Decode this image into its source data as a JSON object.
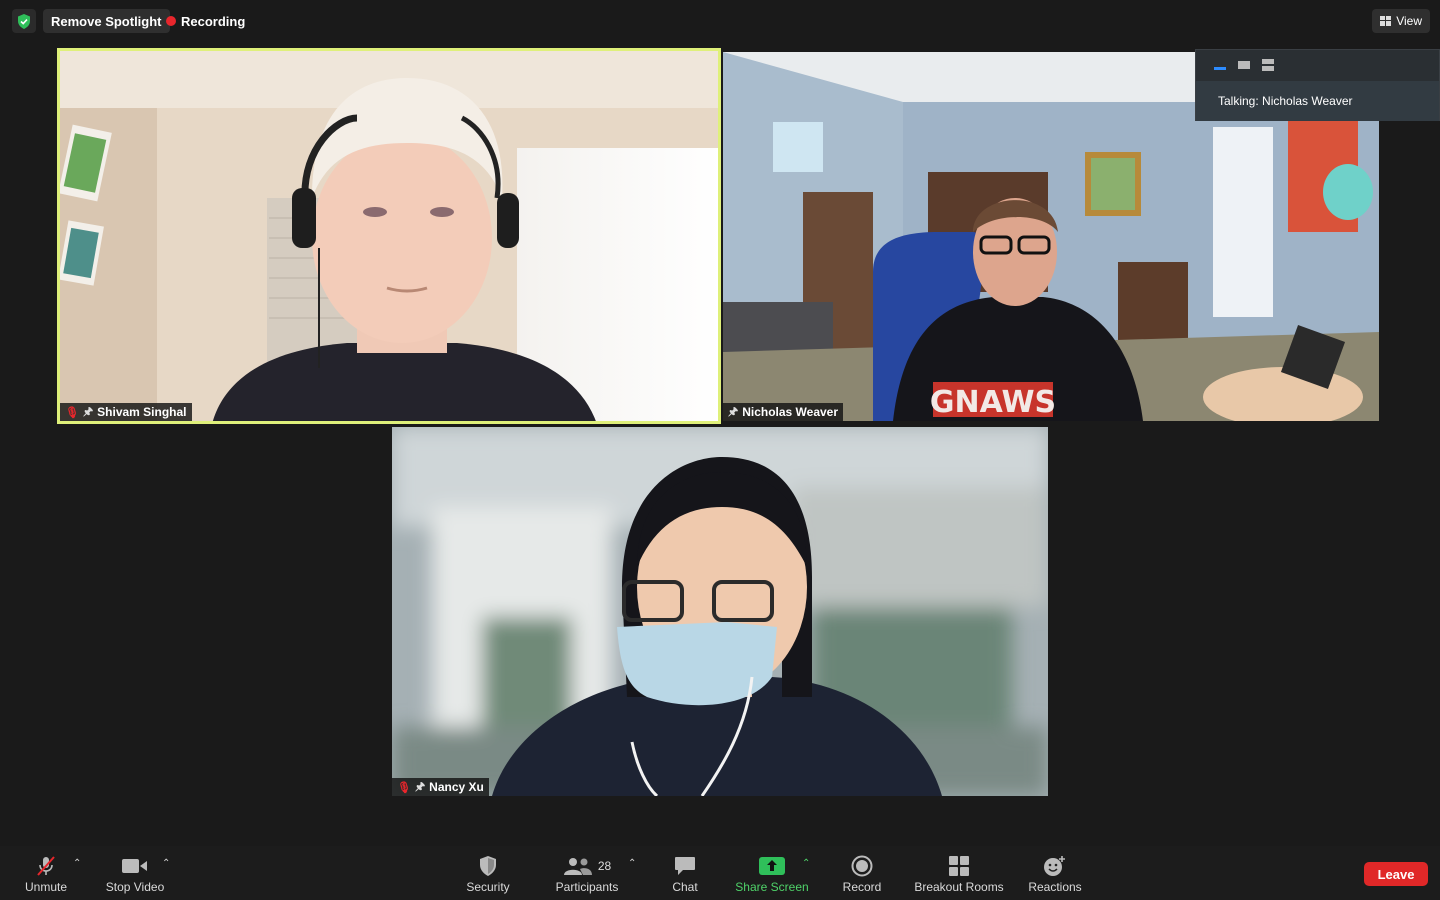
{
  "topbar": {
    "remove_spotlight": "Remove Spotlight",
    "recording": "Recording",
    "view": "View"
  },
  "participants": [
    {
      "name": "Shivam Singhal",
      "muted": true,
      "pinned": true,
      "spotlight": true
    },
    {
      "name": "Nicholas Weaver",
      "muted": false,
      "pinned": true
    },
    {
      "name": "Nancy Xu",
      "muted": true,
      "pinned": true
    }
  ],
  "video_scene": {
    "tile2_shirt_text": "GNAWS"
  },
  "talking": {
    "text": "Talking: Nicholas Weaver"
  },
  "toolbar": {
    "unmute": "Unmute",
    "stop_video": "Stop Video",
    "security": "Security",
    "participants": "Participants",
    "participant_count": "28",
    "chat": "Chat",
    "share_screen": "Share Screen",
    "record": "Record",
    "breakout_rooms": "Breakout Rooms",
    "reactions": "Reactions",
    "leave": "Leave"
  },
  "colors": {
    "active_speaker_border": "#dff07a",
    "share_green": "#4fd269",
    "leave_red": "#e02828",
    "recording_red": "#e8262c"
  }
}
